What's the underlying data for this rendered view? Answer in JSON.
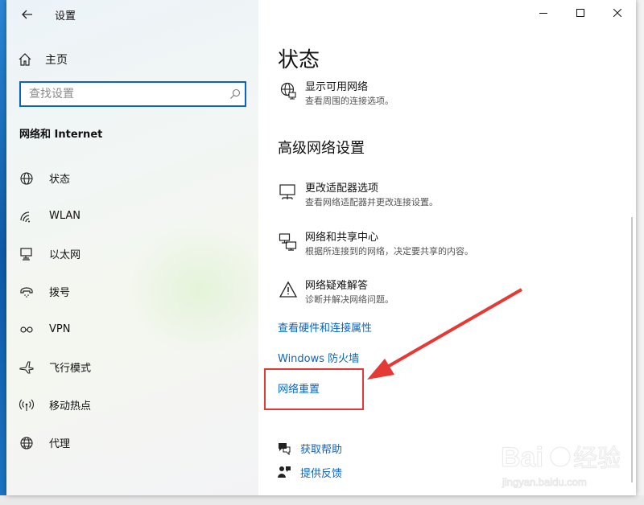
{
  "window": {
    "title": "设置",
    "controls": [
      "minimize",
      "maximize",
      "close"
    ]
  },
  "sidebar": {
    "home_label": "主页",
    "search_placeholder": "查找设置",
    "section_title": "网络和 Internet",
    "items": [
      {
        "label": "状态",
        "icon": "globe-icon"
      },
      {
        "label": "WLAN",
        "icon": "wifi-icon"
      },
      {
        "label": "以太网",
        "icon": "ethernet-icon"
      },
      {
        "label": "拨号",
        "icon": "dialup-icon"
      },
      {
        "label": "VPN",
        "icon": "vpn-icon"
      },
      {
        "label": "飞行模式",
        "icon": "airplane-icon"
      },
      {
        "label": "移动热点",
        "icon": "hotspot-icon"
      },
      {
        "label": "代理",
        "icon": "proxy-globe-icon"
      }
    ]
  },
  "main": {
    "page_title": "状态",
    "available_networks": {
      "title": "显示可用网络",
      "desc": "查看周围的连接选项。",
      "icon": "globe-network-icon"
    },
    "advanced_title": "高级网络设置",
    "advanced_items": [
      {
        "title": "更改适配器选项",
        "desc": "查看网络适配器并更改连接设置。",
        "icon": "adapter-icon"
      },
      {
        "title": "网络和共享中心",
        "desc": "根据所连接到的网络，决定要共享的内容。",
        "icon": "sharing-center-icon"
      },
      {
        "title": "网络疑难解答",
        "desc": "诊断并解决网络问题。",
        "icon": "warning-icon"
      }
    ],
    "links": {
      "hardware_props": "查看硬件和连接属性",
      "firewall": "Windows 防火墙",
      "network_reset": "网络重置"
    },
    "help": {
      "get_help": "获取帮助",
      "feedback": "提供反馈"
    }
  },
  "colors": {
    "accent": "#0a64c6",
    "annotation": "#e53935"
  },
  "watermark": {
    "brand": "Baidu经验",
    "url": "jingyan.baidu.com"
  }
}
